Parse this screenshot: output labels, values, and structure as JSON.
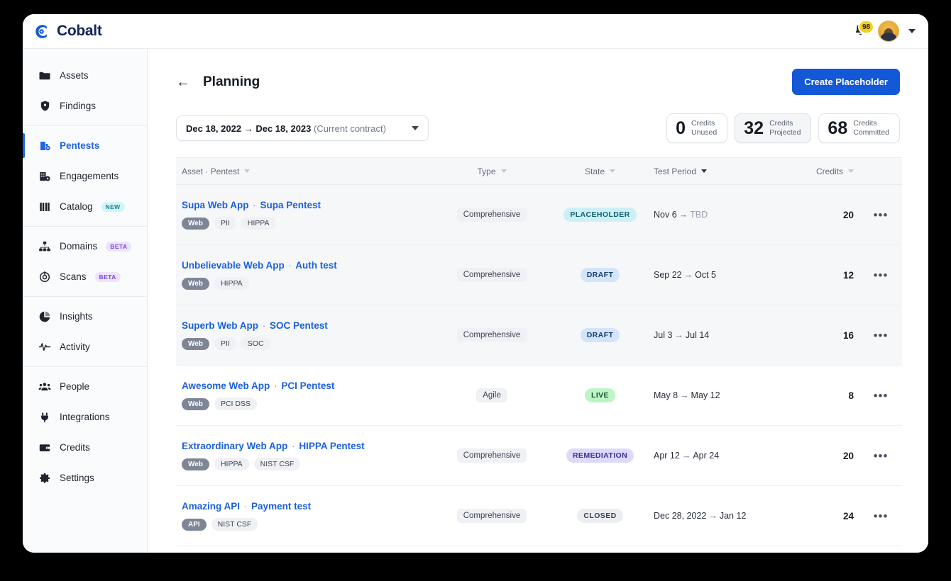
{
  "brand": {
    "name": "Cobalt",
    "logo_icon": "cobalt-logo-icon"
  },
  "topbar": {
    "notification_icon": "bell-icon",
    "notification_count": "98",
    "avatar_icon": "user-avatar",
    "account_caret_icon": "chevron-down-icon"
  },
  "sidebar": {
    "groups": [
      {
        "items": [
          {
            "label": "Assets",
            "icon": "folder-icon",
            "active": false,
            "tag": null
          },
          {
            "label": "Findings",
            "icon": "shield-icon",
            "active": false,
            "tag": null
          }
        ]
      },
      {
        "items": [
          {
            "label": "Pentests",
            "icon": "pentest-icon",
            "active": true,
            "tag": null
          },
          {
            "label": "Engagements",
            "icon": "engagement-icon",
            "active": false,
            "tag": null
          },
          {
            "label": "Catalog",
            "icon": "book-icon",
            "active": false,
            "tag": "NEW",
            "tag_kind": "new"
          }
        ]
      },
      {
        "items": [
          {
            "label": "Domains",
            "icon": "sitemap-icon",
            "active": false,
            "tag": "BETA",
            "tag_kind": "beta"
          },
          {
            "label": "Scans",
            "icon": "scan-icon",
            "active": false,
            "tag": "BETA",
            "tag_kind": "beta"
          }
        ]
      },
      {
        "items": [
          {
            "label": "Insights",
            "icon": "pie-chart-icon",
            "active": false,
            "tag": null
          },
          {
            "label": "Activity",
            "icon": "pulse-icon",
            "active": false,
            "tag": null
          }
        ]
      },
      {
        "items": [
          {
            "label": "People",
            "icon": "people-icon",
            "active": false,
            "tag": null
          },
          {
            "label": "Integrations",
            "icon": "plug-icon",
            "active": false,
            "tag": null
          },
          {
            "label": "Credits",
            "icon": "wallet-icon",
            "active": false,
            "tag": null
          },
          {
            "label": "Settings",
            "icon": "gear-icon",
            "active": false,
            "tag": null
          }
        ]
      }
    ]
  },
  "page": {
    "back_icon": "back-arrow-icon",
    "back_glyph": "←",
    "title": "Planning",
    "create_button": "Create Placeholder"
  },
  "filters": {
    "date_range": {
      "start": "Dec 18, 2022",
      "arrow": "→",
      "end": "Dec 18, 2023",
      "note": "(Current contract)",
      "caret_icon": "chevron-down-icon"
    },
    "credits": [
      {
        "value": "0",
        "label_line1": "Credits",
        "label_line2": "Unused",
        "shaded": false
      },
      {
        "value": "32",
        "label_line1": "Credits",
        "label_line2": "Projected",
        "shaded": true
      },
      {
        "value": "68",
        "label_line1": "Credits",
        "label_line2": "Committed",
        "shaded": false
      }
    ]
  },
  "table": {
    "columns": [
      {
        "label": "Asset · Pentest",
        "sorted": false,
        "align": "left"
      },
      {
        "label": "Type",
        "sorted": false,
        "align": "center"
      },
      {
        "label": "State",
        "sorted": false,
        "align": "center"
      },
      {
        "label": "Test Period",
        "sorted": true,
        "align": "left"
      },
      {
        "label": "Credits",
        "sorted": false,
        "align": "right"
      }
    ],
    "menu_icon": "kebab-menu-icon",
    "menu_glyph": "•••",
    "rows": [
      {
        "asset": "Supa Web App",
        "separator": "·",
        "pentest": "Supa Pentest",
        "kind_chip": "Web",
        "chips": [
          "PII",
          "HIPPA"
        ],
        "type": "Comprehensive",
        "state": "PLACEHOLDER",
        "state_class": "st-placeholder",
        "period_start": "Nov 6",
        "period_arrow": "→",
        "period_end": "TBD",
        "period_end_muted": true,
        "credits": "20",
        "tinted": true
      },
      {
        "asset": "Unbelievable Web App",
        "separator": "·",
        "pentest": "Auth test",
        "kind_chip": "Web",
        "chips": [
          "HIPPA"
        ],
        "type": "Comprehensive",
        "state": "DRAFT",
        "state_class": "st-draft",
        "period_start": "Sep 22",
        "period_arrow": "→",
        "period_end": "Oct 5",
        "period_end_muted": false,
        "credits": "12",
        "tinted": true
      },
      {
        "asset": "Superb Web App",
        "separator": "·",
        "pentest": "SOC Pentest",
        "kind_chip": "Web",
        "chips": [
          "PII",
          "SOC"
        ],
        "type": "Comprehensive",
        "state": "DRAFT",
        "state_class": "st-draft",
        "period_start": "Jul 3",
        "period_arrow": "→",
        "period_end": "Jul 14",
        "period_end_muted": false,
        "credits": "16",
        "tinted": true
      },
      {
        "asset": "Awesome Web App",
        "separator": "·",
        "pentest": "PCI Pentest",
        "kind_chip": "Web",
        "chips": [
          "PCI DSS"
        ],
        "type": "Agile",
        "state": "LIVE",
        "state_class": "st-live",
        "period_start": "May 8",
        "period_arrow": "→",
        "period_end": "May 12",
        "period_end_muted": false,
        "credits": "8",
        "tinted": false
      },
      {
        "asset": "Extraordinary Web App",
        "separator": "·",
        "pentest": "HIPPA Pentest",
        "kind_chip": "Web",
        "chips": [
          "HIPPA",
          "NIST CSF"
        ],
        "type": "Comprehensive",
        "state": "REMEDIATION",
        "state_class": "st-remediation",
        "period_start": "Apr 12",
        "period_arrow": "→",
        "period_end": "Apr 24",
        "period_end_muted": false,
        "credits": "20",
        "tinted": false
      },
      {
        "asset": "Amazing API",
        "separator": "·",
        "pentest": "Payment test",
        "kind_chip": "API",
        "chips": [
          "NIST CSF"
        ],
        "type": "Comprehensive",
        "state": "CLOSED",
        "state_class": "st-closed",
        "period_start": "Dec 28, 2022",
        "period_arrow": "→",
        "period_end": "Jan 12",
        "period_end_muted": false,
        "credits": "24",
        "tinted": false
      }
    ]
  },
  "colors": {
    "brand_blue": "#1358d6",
    "logo_navy": "#13235b",
    "link_blue": "#1b61dd",
    "badge_yellow": "#f5d016"
  }
}
